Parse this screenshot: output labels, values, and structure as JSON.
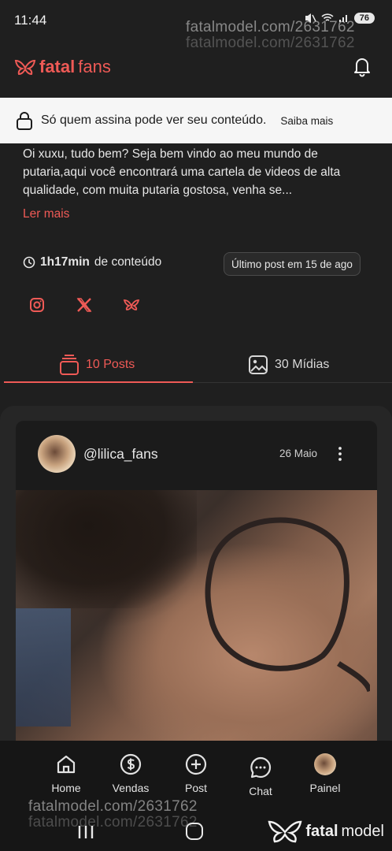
{
  "status_bar": {
    "time": "11:44",
    "battery": "76"
  },
  "watermark": {
    "text": "fatalmodel.com/2631762"
  },
  "header": {
    "brand_prefix": "fatal",
    "brand_suffix": "fans"
  },
  "notice": {
    "text": "Só quem assina pode ver seu conteúdo.",
    "link": "Saiba mais"
  },
  "profile": {
    "bio": "Oi xuxu, tudo bem? Seja bem vindo ao meu mundo de putaria,aqui você encontrará uma cartela de videos de alta qualidade, com muita putaria gostosa, venha se...",
    "read_more": "Ler mais",
    "content_duration": "1h17min",
    "content_suffix": "de conteúdo",
    "last_post": "Último post em 15 de ago",
    "socials": [
      "instagram-icon",
      "x-icon",
      "bluesky-icon"
    ]
  },
  "tabs": [
    {
      "label": "10 Posts",
      "active": true
    },
    {
      "label": "30 Mídias",
      "active": false
    }
  ],
  "post": {
    "username": "@lilica_fans",
    "date": "26 Maio"
  },
  "bottom_nav": [
    {
      "label": "Home",
      "icon": "home-icon"
    },
    {
      "label": "Vendas",
      "icon": "dollar-icon"
    },
    {
      "label": "Post",
      "icon": "plus-circle-icon"
    },
    {
      "label": "Chat",
      "icon": "chat-icon"
    },
    {
      "label": "Painel",
      "icon": "avatar"
    }
  ],
  "footer_brand": {
    "prefix": "fatal",
    "suffix": "model"
  },
  "colors": {
    "accent": "#ef5a56",
    "background": "#1f1f1f",
    "notice_bg": "#f6f6f6"
  }
}
